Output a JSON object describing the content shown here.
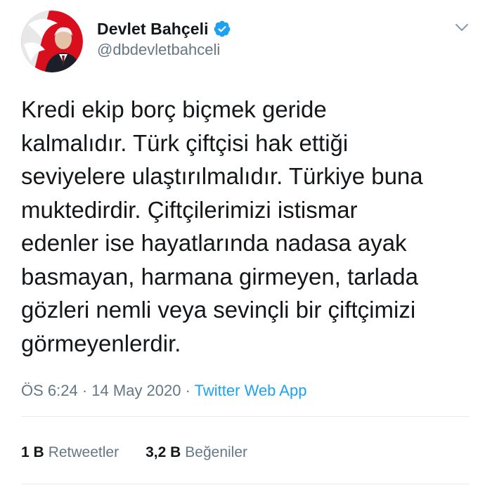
{
  "author": {
    "display_name": "Devlet Bahçeli",
    "handle": "@dbdevletbahceli",
    "verified": true,
    "avatar_icon": "profile-photo"
  },
  "tweet": {
    "text_lines": [
      "Kredi ekip borç biçmek geride",
      "kalmalıdır. Türk çiftçisi hak ettiği",
      "seviyelere ulaştırılmalıdır. Türkiye buna",
      "muktedirdir. Çiftçilerimizi istismar",
      "edenler ise hayatlarında nadasa ayak",
      "basmayan, harmana girmeyen, tarlada",
      "gözleri nemli veya sevinçli bir çiftçimizi",
      "görmeyenlerdir."
    ]
  },
  "meta": {
    "time": "ÖS 6:24",
    "separator": "·",
    "date": "14 May 2020",
    "source": "Twitter Web App"
  },
  "stats": {
    "retweets_count": "1 B",
    "retweets_label": "Retweetler",
    "likes_count": "3,2 B",
    "likes_label": "Beğeniler"
  },
  "colors": {
    "text": "#14171a",
    "secondary": "#657786",
    "link": "#1da1f2",
    "verified_badge": "#1da1f2",
    "divider": "#e6ecf0"
  }
}
